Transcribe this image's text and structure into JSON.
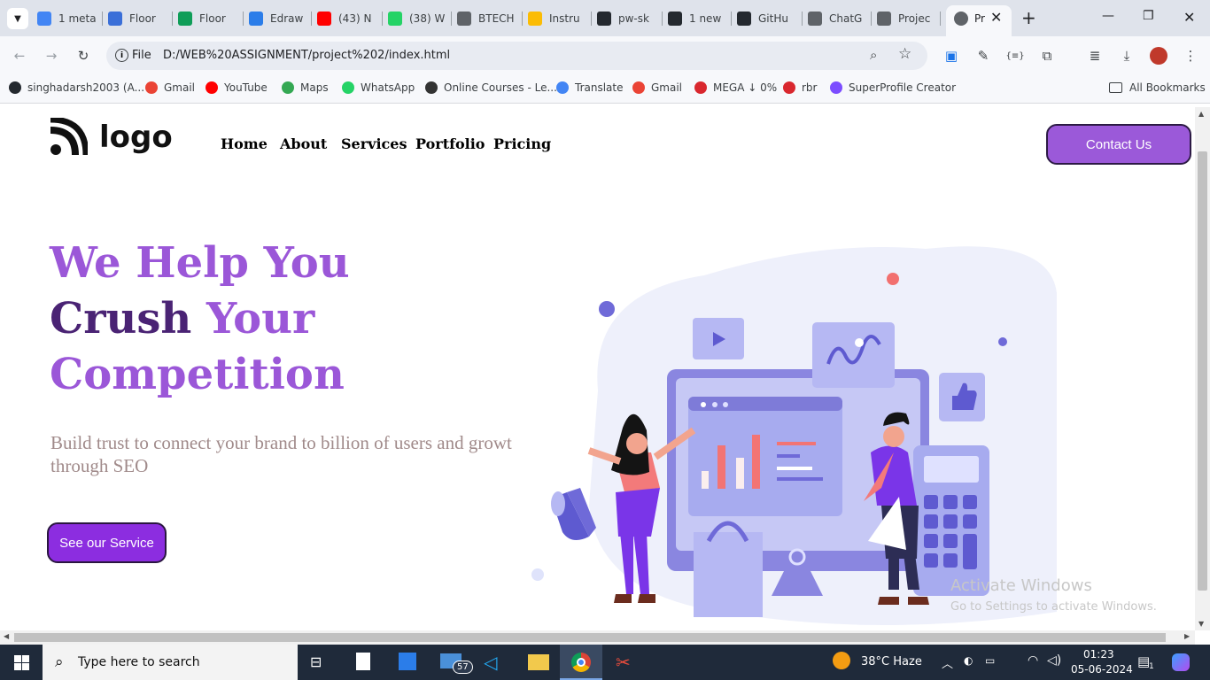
{
  "browser": {
    "tabs": [
      {
        "label": "1 meta",
        "color": "#4285f4"
      },
      {
        "label": "Floor",
        "color": "#3b6fd8"
      },
      {
        "label": "Floor",
        "color": "#0f9d58"
      },
      {
        "label": "Edraw",
        "color": "#2b7de9"
      },
      {
        "label": "(43) N",
        "color": "#ff0000"
      },
      {
        "label": "(38) W",
        "color": "#25d366"
      },
      {
        "label": "BTECH",
        "color": "#5f6368"
      },
      {
        "label": "Instru",
        "color": "#fbbc04"
      },
      {
        "label": "pw-sk",
        "color": "#24292f"
      },
      {
        "label": "1 new",
        "color": "#24292f"
      },
      {
        "label": "GitHu",
        "color": "#24292f"
      },
      {
        "label": "ChatG",
        "color": "#5f6368"
      },
      {
        "label": "Projec",
        "color": "#5f6368"
      }
    ],
    "active_tab": {
      "label": "Pr"
    },
    "address": {
      "scheme_label": "File",
      "url": "D:/WEB%20ASSIGNMENT/project%202/index.html"
    },
    "bookmarks": [
      {
        "label": "singhadarsh2003 (A...",
        "color": "#24292f"
      },
      {
        "label": "Gmail",
        "color": "#ea4335"
      },
      {
        "label": "YouTube",
        "color": "#ff0000"
      },
      {
        "label": "Maps",
        "color": "#34a853"
      },
      {
        "label": "WhatsApp",
        "color": "#25d366"
      },
      {
        "label": "Online Courses - Le...",
        "color": "#333333"
      },
      {
        "label": "Translate",
        "color": "#4285f4"
      },
      {
        "label": "Gmail",
        "color": "#ea4335"
      },
      {
        "label": "MEGA ↓ 0%",
        "color": "#d9272e"
      },
      {
        "label": "rbr",
        "color": "#d9272e"
      },
      {
        "label": "SuperProfile Creator",
        "color": "#7c4dff"
      }
    ],
    "all_bookmarks": "All Bookmarks"
  },
  "site": {
    "logo_text": "logo",
    "nav": [
      "Home",
      "About",
      "Services",
      "Portfolio",
      "Pricing"
    ],
    "contact_button": "Contact Us",
    "hero": {
      "line1": "We Help You",
      "line2_a": "Crush",
      "line2_b": "Your",
      "line3": "Competition",
      "colors": {
        "light": "#9b57d8",
        "dark": "#4a2374"
      }
    },
    "subtitle_line1": "Build trust to connect your brand to billion of users and growt",
    "subtitle_line2": "through SEO",
    "cta_button": "See our Service"
  },
  "watermark": {
    "title": "Activate Windows",
    "subtitle": "Go to Settings to activate Windows."
  },
  "taskbar": {
    "search_placeholder": "Type here to search",
    "mail_badge": "57",
    "weather": "38°C  Haze",
    "time": "01:23",
    "date": "05-06-2024",
    "notification_count": "1"
  }
}
